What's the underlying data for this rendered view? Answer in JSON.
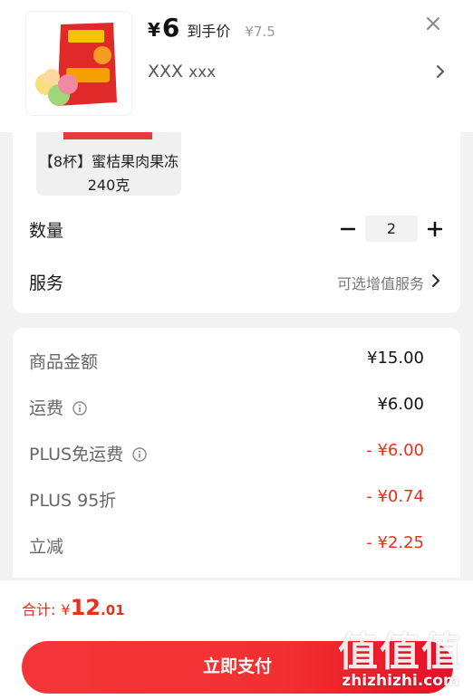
{
  "product": {
    "price_currency": "¥",
    "price": "6",
    "price_label": "到手价",
    "original_price": "¥7.5",
    "spec_main": "XXX",
    "spec_sub": "xxx"
  },
  "variant": {
    "label": "【8杯】蜜桔果肉果冻240克"
  },
  "quantity": {
    "label": "数量",
    "value": "2"
  },
  "service": {
    "label": "服务",
    "hint": "可选增值服务"
  },
  "price_rows": [
    {
      "label": "商品金额",
      "value": "¥15.00",
      "info": false,
      "discount": false
    },
    {
      "label": "运费",
      "value": "¥6.00",
      "info": true,
      "discount": false
    },
    {
      "label": "PLUS免运费",
      "value": "- ¥6.00",
      "info": true,
      "discount": true
    },
    {
      "label": "PLUS 95折",
      "value": "- ¥0.74",
      "info": false,
      "discount": true
    },
    {
      "label": "立减",
      "value": "- ¥2.25",
      "info": false,
      "discount": true
    }
  ],
  "total": {
    "label": "合计:",
    "currency": "¥",
    "integer": "12",
    "decimal": ".01"
  },
  "pay_button": "立即支付",
  "watermark": {
    "logo": "值值值",
    "text": "zhizhizhi.com"
  },
  "colors": {
    "accent_red": "#e8301b",
    "button_red": "#f23030"
  }
}
